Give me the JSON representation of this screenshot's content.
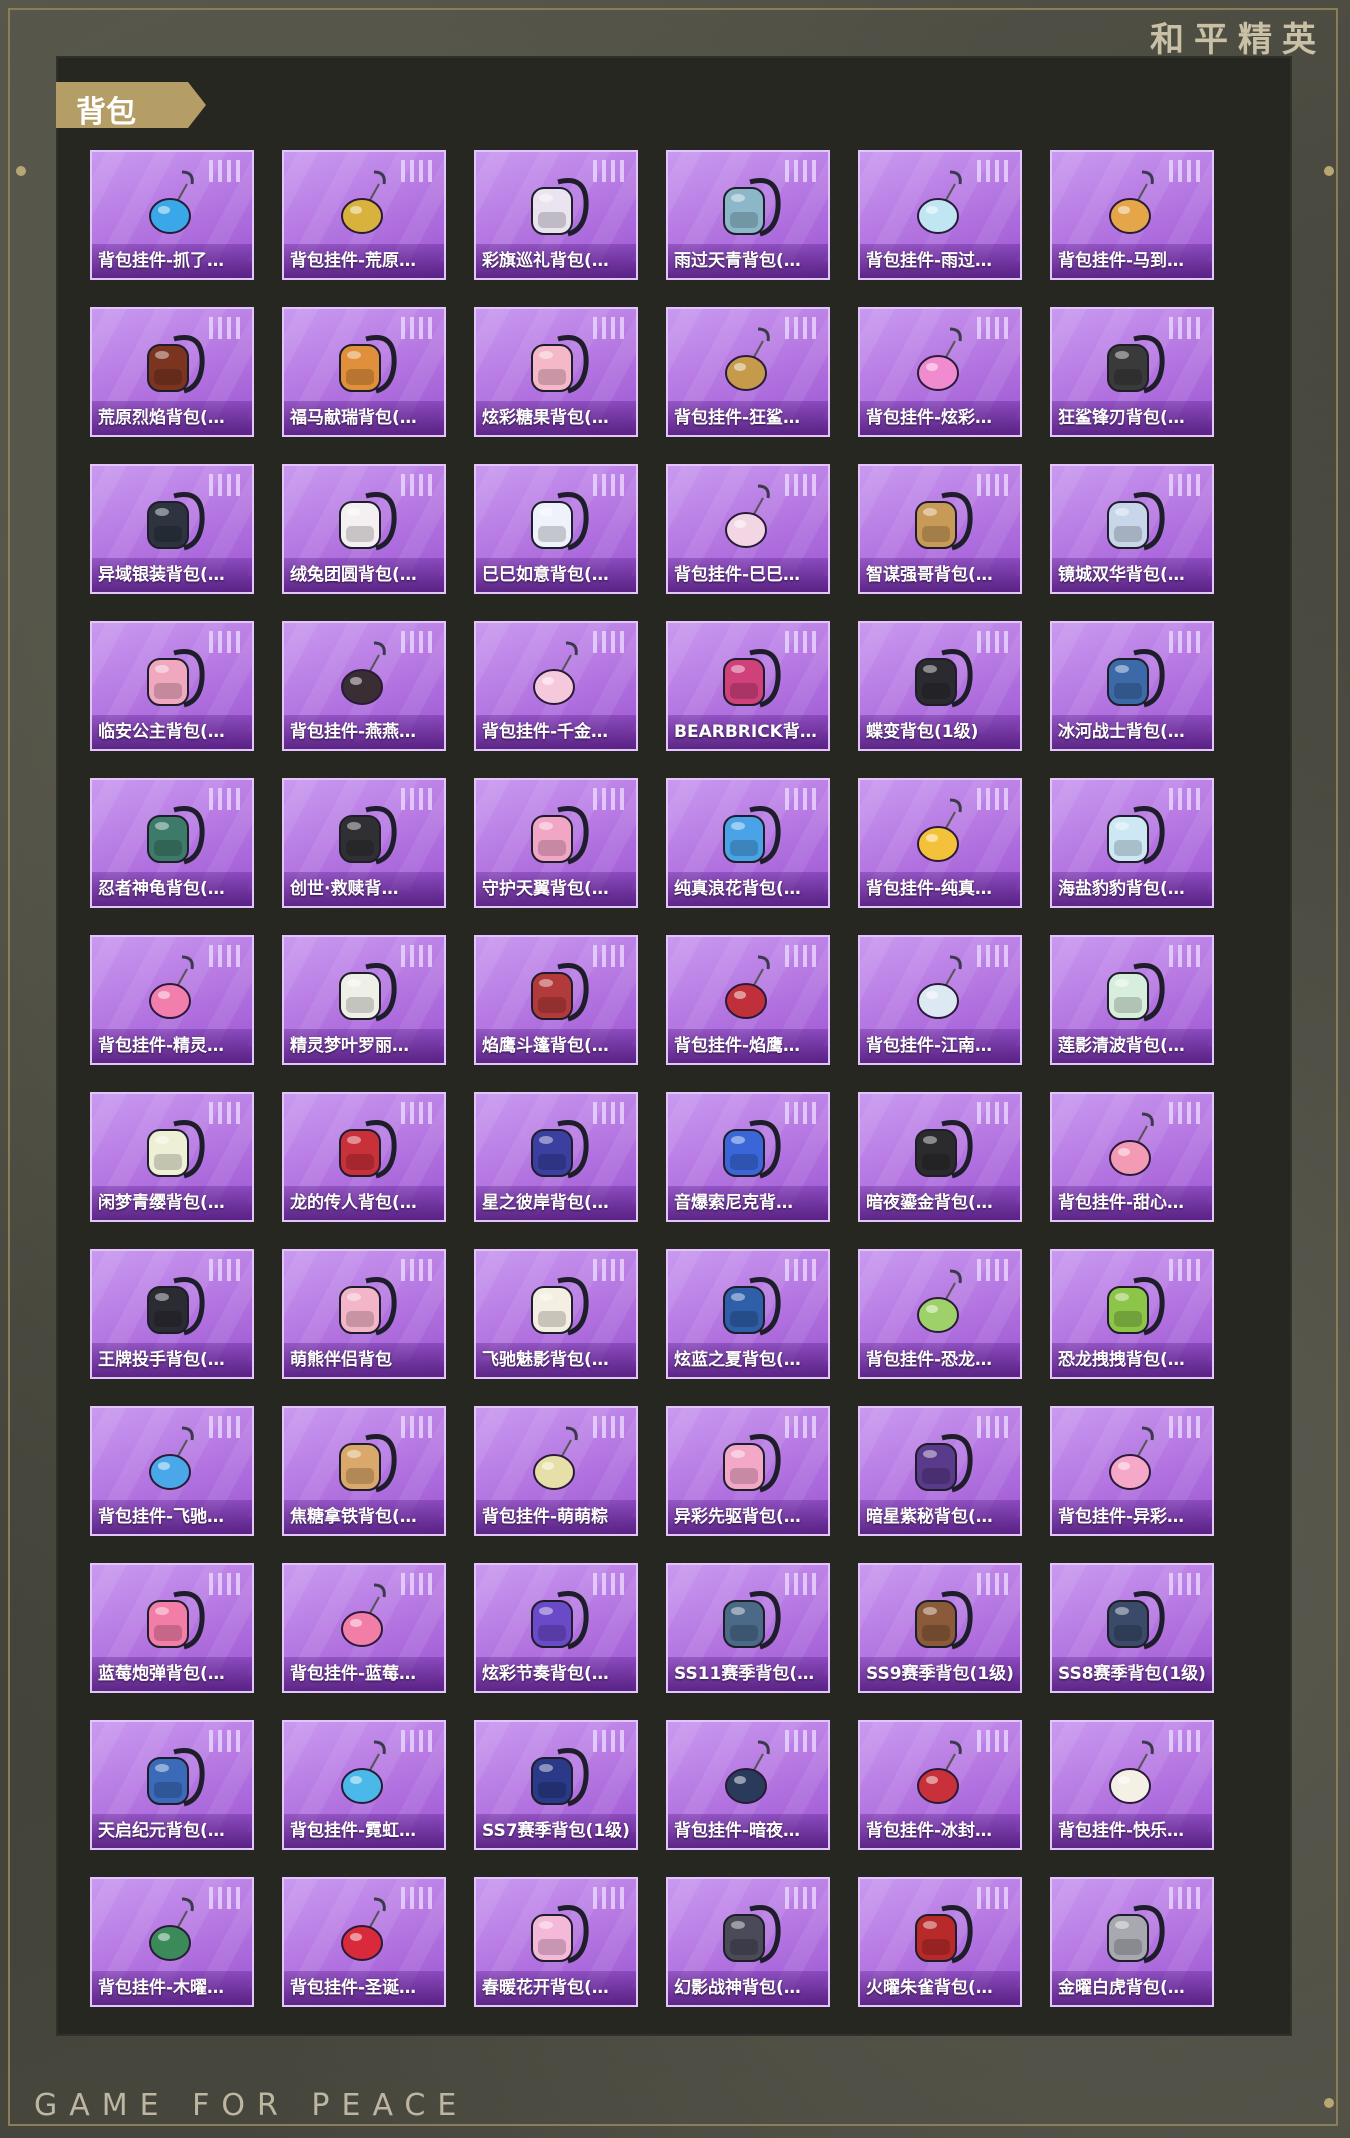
{
  "brand": {
    "title": "和平精英",
    "footer": "GAME FOR PEACE"
  },
  "section": {
    "label": "背包"
  },
  "colors": {
    "card_purple": "#b77ae3",
    "tag_gold": "#b59e66",
    "panel_dark": "#262721"
  },
  "items": [
    {
      "name": "背包挂件-抓了…",
      "icon": "whale-charm-icon",
      "accent": "#3aa8e8"
    },
    {
      "name": "背包挂件-荒原…",
      "icon": "sun-charm-icon",
      "accent": "#d8b23c"
    },
    {
      "name": "彩旗巡礼背包(…",
      "icon": "bunny-backpack-icon",
      "accent": "#e9e4ef"
    },
    {
      "name": "雨过天青背包(…",
      "icon": "slim-backpack-icon",
      "accent": "#8bb7c8"
    },
    {
      "name": "背包挂件-雨过…",
      "icon": "sword-charm-icon",
      "accent": "#bfe6f2"
    },
    {
      "name": "背包挂件-马到…",
      "icon": "horse-charm-icon",
      "accent": "#e5a64a"
    },
    {
      "name": "荒原烈焰背包(…",
      "icon": "flame-backpack-icon",
      "accent": "#7a3420"
    },
    {
      "name": "福马献瑞背包(…",
      "icon": "horse-backpack-icon",
      "accent": "#e08f3a"
    },
    {
      "name": "炫彩糖果背包(…",
      "icon": "candy-backpack-icon",
      "accent": "#f4b8c8"
    },
    {
      "name": "背包挂件-狂鲨…",
      "icon": "fin-charm-icon",
      "accent": "#c59a4b"
    },
    {
      "name": "背包挂件-炫彩…",
      "icon": "candy-charm-icon",
      "accent": "#f08bd0"
    },
    {
      "name": "狂鲨锋刃背包(…",
      "icon": "shark-backpack-icon",
      "accent": "#3a3a3a"
    },
    {
      "name": "异域银装背包(…",
      "icon": "tech-backpack-icon",
      "accent": "#2d3440"
    },
    {
      "name": "绒兔团圆背包(…",
      "icon": "plush-bunny-icon",
      "accent": "#f4f0f2"
    },
    {
      "name": "巳巳如意背包(…",
      "icon": "round-pet-backpack-icon",
      "accent": "#eef3fb"
    },
    {
      "name": "背包挂件-巳巳…",
      "icon": "pet-charm-icon",
      "accent": "#f3d6e4"
    },
    {
      "name": "智谋强哥背包(…",
      "icon": "bear-face-backpack-icon",
      "accent": "#c89a58"
    },
    {
      "name": "镜城双华背包(…",
      "icon": "ornate-backpack-icon",
      "accent": "#c8d6ea"
    },
    {
      "name": "临安公主背包(…",
      "icon": "flower-backpack-icon",
      "accent": "#f0a8bf"
    },
    {
      "name": "背包挂件-燕燕…",
      "icon": "swallow-charm-icon",
      "accent": "#3a2e35"
    },
    {
      "name": "背包挂件-千金…",
      "icon": "cat-charm-icon",
      "accent": "#f6c8dc"
    },
    {
      "name": "BEARBRICK背…",
      "icon": "bearbrick-backpack-icon",
      "accent": "#d0407a"
    },
    {
      "name": "蝶变背包(1级)",
      "icon": "butterfly-backpack-icon",
      "accent": "#2a2a30"
    },
    {
      "name": "冰河战士背包(…",
      "icon": "armor-backpack-icon",
      "accent": "#3c6aa8"
    },
    {
      "name": "忍者神龟背包(…",
      "icon": "turtle-backpack-icon",
      "accent": "#3d7a6a"
    },
    {
      "name": "创世·救赎背…",
      "icon": "drone-backpack-icon",
      "accent": "#303034"
    },
    {
      "name": "守护天翼背包(…",
      "icon": "wing-backpack-icon",
      "accent": "#f2a6c6"
    },
    {
      "name": "纯真浪花背包(…",
      "icon": "wave-backpack-icon",
      "accent": "#4aa3e6"
    },
    {
      "name": "背包挂件-纯真…",
      "icon": "key-charm-icon",
      "accent": "#f4c23a"
    },
    {
      "name": "海盐豹豹背包(…",
      "icon": "seal-backpack-icon",
      "accent": "#cde8f4"
    },
    {
      "name": "背包挂件-精灵…",
      "icon": "heart-wing-charm-icon",
      "accent": "#f27eae"
    },
    {
      "name": "精灵梦叶罗丽…",
      "icon": "fairy-purse-icon",
      "accent": "#eef0e8"
    },
    {
      "name": "焰鹰斗篷背包(…",
      "icon": "cloak-backpack-icon",
      "accent": "#b33a3a"
    },
    {
      "name": "背包挂件-焰鹰…",
      "icon": "knot-charm-icon",
      "accent": "#c0303a"
    },
    {
      "name": "背包挂件-江南…",
      "icon": "lantern-charm-icon",
      "accent": "#dce9f2"
    },
    {
      "name": "莲影清波背包(…",
      "icon": "lotus-backpack-icon",
      "accent": "#d8eedc"
    },
    {
      "name": "闲梦青缨背包(…",
      "icon": "tassel-backpack-icon",
      "accent": "#eef0d6"
    },
    {
      "name": "龙的传人背包(…",
      "icon": "school-backpack-icon",
      "accent": "#c8303a"
    },
    {
      "name": "星之彼岸背包(…",
      "icon": "galaxy-backpack-icon",
      "accent": "#3a3fa0"
    },
    {
      "name": "音爆索尼克背…",
      "icon": "pixel-backpack-icon",
      "accent": "#3a66d8"
    },
    {
      "name": "暗夜鎏金背包(…",
      "icon": "dark-gold-backpack-icon",
      "accent": "#2b2a2c"
    },
    {
      "name": "背包挂件-甜心…",
      "icon": "paw-charm-icon",
      "accent": "#f39ab4"
    },
    {
      "name": "王牌投手背包(…",
      "icon": "pitcher-backpack-icon",
      "accent": "#2b2b33"
    },
    {
      "name": "萌熊伴侣背包",
      "icon": "teddy-bear-icon",
      "accent": "#f3b5c8"
    },
    {
      "name": "飞驰魅影背包(…",
      "icon": "egg-backpack-icon",
      "accent": "#f4efe2"
    },
    {
      "name": "炫蓝之夏背包(…",
      "icon": "blue-backpack-icon",
      "accent": "#2f5fa8"
    },
    {
      "name": "背包挂件-恐龙…",
      "icon": "dino-egg-charm-icon",
      "accent": "#9fd16a"
    },
    {
      "name": "恐龙拽拽背包(…",
      "icon": "dino-backpack-icon",
      "accent": "#8cc548"
    },
    {
      "name": "背包挂件-飞驰…",
      "icon": "winged-orb-charm-icon",
      "accent": "#4aa8e8"
    },
    {
      "name": "焦糖拿铁背包(…",
      "icon": "latte-backpack-icon",
      "accent": "#d9a86a"
    },
    {
      "name": "背包挂件-萌萌粽",
      "icon": "zongzi-charm-icon",
      "accent": "#e6e0a8"
    },
    {
      "name": "异彩先驱背包(…",
      "icon": "pig-backpack-icon",
      "accent": "#f3a8c8"
    },
    {
      "name": "暗星紫秘背包(…",
      "icon": "amethyst-backpack-icon",
      "accent": "#5a3a8a"
    },
    {
      "name": "背包挂件-异彩…",
      "icon": "rollerskate-charm-icon",
      "accent": "#f6a8c8"
    },
    {
      "name": "蓝莓炮弹背包(…",
      "icon": "cake-backpack-icon",
      "accent": "#f27ea8"
    },
    {
      "name": "背包挂件-蓝莓…",
      "icon": "icecream-charm-icon",
      "accent": "#f27ea8"
    },
    {
      "name": "炫彩节奏背包(…",
      "icon": "graffiti-backpack-icon",
      "accent": "#6a4ac8"
    },
    {
      "name": "SS11赛季背包(…",
      "icon": "season-11-backpack-icon",
      "accent": "#4a6a88"
    },
    {
      "name": "SS9赛季背包(1级)",
      "icon": "season-9-backpack-icon",
      "accent": "#8a5a3a"
    },
    {
      "name": "SS8赛季背包(1级)",
      "icon": "season-8-backpack-icon",
      "accent": "#3a4a68"
    },
    {
      "name": "天启纪元背包(…",
      "icon": "apocalypse-backpack-icon",
      "accent": "#3a6ab8"
    },
    {
      "name": "背包挂件-霓虹…",
      "icon": "neon-charm-icon",
      "accent": "#4ab8e8"
    },
    {
      "name": "SS7赛季背包(1级)",
      "icon": "season-7-backpack-icon",
      "accent": "#2a3a88"
    },
    {
      "name": "背包挂件-暗夜…",
      "icon": "dark-orb-charm-icon",
      "accent": "#2a3a5a"
    },
    {
      "name": "背包挂件-冰封…",
      "icon": "frozen-charm-icon",
      "accent": "#c8303a"
    },
    {
      "name": "背包挂件-快乐…",
      "icon": "chick-charm-icon",
      "accent": "#f4f0e6"
    },
    {
      "name": "背包挂件-木曜…",
      "icon": "leaf-beast-charm-icon",
      "accent": "#3a8a5a"
    },
    {
      "name": "背包挂件-圣诞…",
      "icon": "santa-hat-charm-icon",
      "accent": "#d82a3a"
    },
    {
      "name": "春暖花开背包(…",
      "icon": "blossom-backpack-icon",
      "accent": "#f4b8d8"
    },
    {
      "name": "幻影战神背包(…",
      "icon": "phantom-backpack-icon",
      "accent": "#4a4a58"
    },
    {
      "name": "火曜朱雀背包(…",
      "icon": "vermilion-backpack-icon",
      "accent": "#b82a2a"
    },
    {
      "name": "金曜白虎背包(…",
      "icon": "tiger-backpack-icon",
      "accent": "#a8a8b0"
    }
  ]
}
